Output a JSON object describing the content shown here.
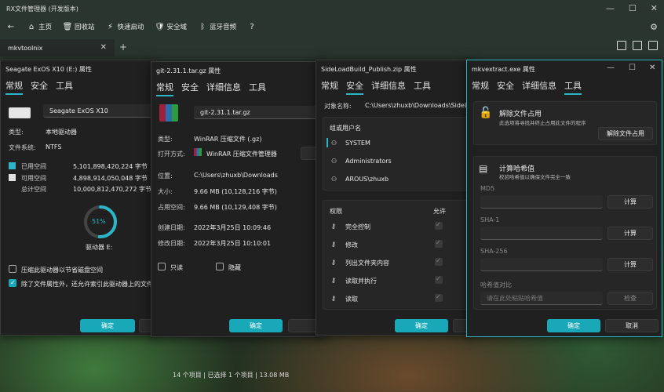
{
  "app": {
    "title": "RX文件管理器 (开发版本)"
  },
  "toolbar": {
    "home": "主页",
    "recycle": "回收站",
    "quick": "快速启动",
    "security": "安全域",
    "bluetooth": "蓝牙音频"
  },
  "tab": {
    "label": "mkvtoolnix"
  },
  "status": {
    "text": "14 个项目 | 已选择 1 个项目 | 13.08 MB"
  },
  "d1": {
    "title": "Seagate ExOS X10 (E:) 属性",
    "tabs": [
      "常规",
      "安全",
      "工具"
    ],
    "name": "Seagate ExOS X10",
    "type_label": "类型:",
    "type_value": "本地驱动器",
    "fs_label": "文件系统:",
    "fs_value": "NTFS",
    "used_label": "已用空间",
    "used_value": "5,101,898,420,224 字节",
    "free_label": "可用空间",
    "free_value": "4,898,914,050,048 字节",
    "total_label": "总计空间",
    "total_value": "10,000,812,470,272 字节",
    "percent": "51%",
    "drive_label": "驱动器 E:",
    "compress": "压缩此驱动器以节省磁盘空间",
    "index": "除了文件属性外，还允许索引此驱动器上的文件",
    "ok": "确定",
    "percent_used": 0.51
  },
  "d2": {
    "title": "git-2.31.1.tar.gz 属性",
    "tabs": [
      "常规",
      "安全",
      "详细信息",
      "工具"
    ],
    "filename": "git-2.31.1.tar.gz",
    "type_label": "类型:",
    "type_value": "WinRAR 压缩文件 (.gz)",
    "open_label": "打开方式:",
    "open_value": "WinRAR 压缩文件管理器",
    "loc_label": "位置:",
    "loc_value": "C:\\Users\\zhuxb\\Downloads",
    "size_label": "大小:",
    "size_value": "9.66 MB (10,128,216 字节)",
    "disk_label": "占用空间:",
    "disk_value": "9.66 MB (10,129,408 字节)",
    "created_label": "创建日期:",
    "created_value": "2022年3月25日 10:09:46",
    "modified_label": "修改日期:",
    "modified_value": "2022年3月25日 10:10:01",
    "readonly": "只读",
    "hidden": "隐藏",
    "ok": "确定"
  },
  "d3": {
    "title": "SideLoadBuild_Publish.zip 属性",
    "tabs": [
      "常规",
      "安全",
      "详细信息",
      "工具"
    ],
    "object_label": "对象名称:",
    "object_value": "C:\\Users\\zhuxb\\Downloads\\SideLoadB",
    "group_header": "组或用户名",
    "users": [
      "SYSTEM",
      "Administrators",
      "AROUS\\zhuxb"
    ],
    "perm_header": "权限",
    "allow_header": "允许",
    "perms": [
      "完全控制",
      "修改",
      "列出文件夹内容",
      "读取并执行",
      "读取"
    ],
    "ok": "确定"
  },
  "d4": {
    "title": "mkvextract.exe 属性",
    "tabs": [
      "常规",
      "安全",
      "详细信息",
      "工具"
    ],
    "unlock_title": "解除文件占用",
    "unlock_desc": "此选项将寻找并终止占用此文件的程序",
    "unlock_btn": "解除文件占用",
    "hash_title": "计算哈希值",
    "hash_desc": "校验哈希值以确保文件完全一致",
    "md5": "MD5",
    "sha1": "SHA-1",
    "sha256": "SHA-256",
    "calc": "计算",
    "compare_label": "哈希值对比",
    "compare_placeholder": "请在此处粘贴哈希值",
    "check": "检查",
    "ok": "确定",
    "cancel": "取消"
  },
  "colors": {
    "accent": "#19a8b8",
    "used": "#2bb5c7",
    "free": "#e0e0e0"
  }
}
